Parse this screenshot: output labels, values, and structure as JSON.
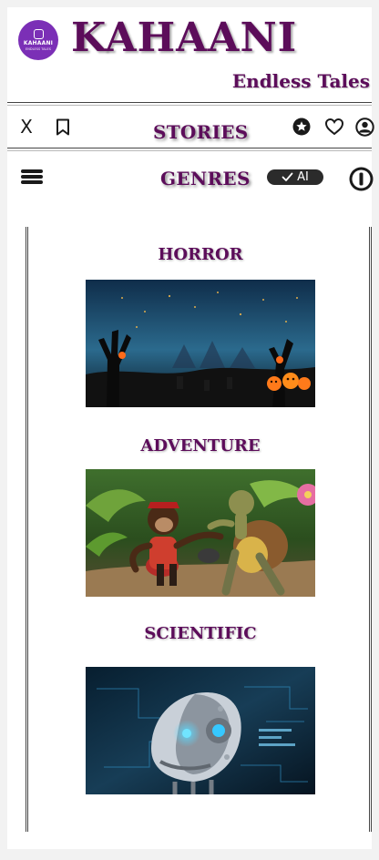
{
  "app": {
    "logo_text": "KAHAANI",
    "logo_subtext": "ENDLESS TALES",
    "title": "KAHAANI",
    "tagline": "Endless Tales",
    "brand_color": "#5c0d5a",
    "logo_color": "#7b2fb6"
  },
  "toolbar": {
    "close_label": "X",
    "title": "STORIES",
    "icons": [
      "close-icon",
      "bookmark-icon",
      "star-icon",
      "heart-icon",
      "user-icon"
    ]
  },
  "sub_toolbar": {
    "title": "GENRES",
    "ai_toggle_label": "AI",
    "ai_toggle_checked": true,
    "icons": [
      "menu-icon",
      "check-icon",
      "info-icon"
    ]
  },
  "genres": [
    {
      "name": "HORROR",
      "image": "haunted graveyard at night with pumpkins"
    },
    {
      "name": "ADVENTURE",
      "image": "chimpanzee and tortoise in jungle"
    },
    {
      "name": "SCIENTIFIC",
      "image": "robot face with circuit background"
    }
  ]
}
